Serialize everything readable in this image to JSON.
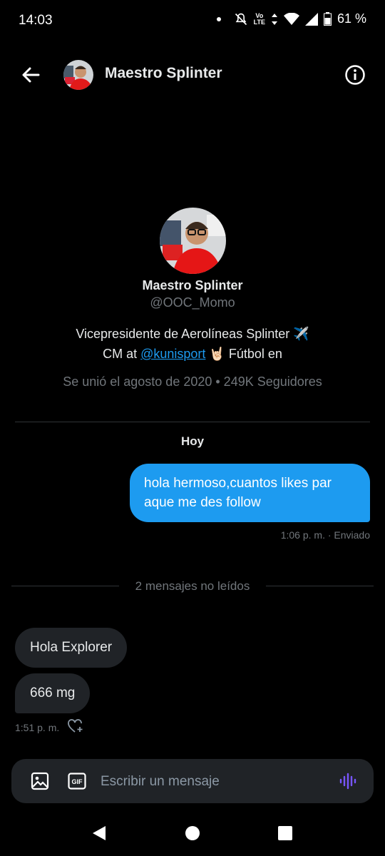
{
  "status_bar": {
    "time": "14:03",
    "lte_top": "Vo",
    "lte_bottom": "LTE",
    "battery": "61 %"
  },
  "header": {
    "title": "Maestro Splinter"
  },
  "profile": {
    "name": "Maestro Splinter",
    "handle": "@OOC_Momo",
    "bio_line1": "Vicepresidente de Aerolíneas Splinter ✈️",
    "bio_line2_prefix": "CM at ",
    "bio_link": "@kunisport",
    "bio_line2_suffix": " 🤘🏻 Fútbol en",
    "meta": "Se unió el agosto de 2020 • 249K Seguidores"
  },
  "conversation": {
    "day_label": "Hoy",
    "outgoing": {
      "text": "hola hermoso,cuantos likes par aque me des follow",
      "meta": "1:06 p. m. · Enviado"
    },
    "unread_label": "2 mensajes no leídos",
    "incoming": [
      {
        "text": "Hola Explorer"
      },
      {
        "text": "666 mg"
      }
    ],
    "incoming_meta": "1:51 p. m."
  },
  "composer": {
    "placeholder": "Escribir un mensaje",
    "gif_label": "GIF"
  },
  "colors": {
    "accent": "#1d9bf0",
    "bubble_in": "#202327",
    "background": "#000000",
    "voice": "#7856ff"
  }
}
